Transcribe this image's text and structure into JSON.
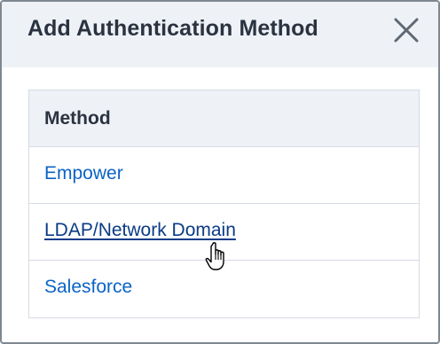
{
  "dialog": {
    "title": "Add Authentication Method",
    "close_icon": "close-icon"
  },
  "table": {
    "column_header": "Method",
    "rows": [
      {
        "label": "Empower"
      },
      {
        "label": "LDAP/Network Domain",
        "hovered": true
      },
      {
        "label": "Salesforce"
      }
    ]
  },
  "colors": {
    "header_bg": "#eef1f6",
    "title_text": "#2a3340",
    "link": "#0b63c6",
    "link_hover": "#0a3b86",
    "border": "#d6dbe2"
  },
  "cursor": "hand-pointer-cursor"
}
